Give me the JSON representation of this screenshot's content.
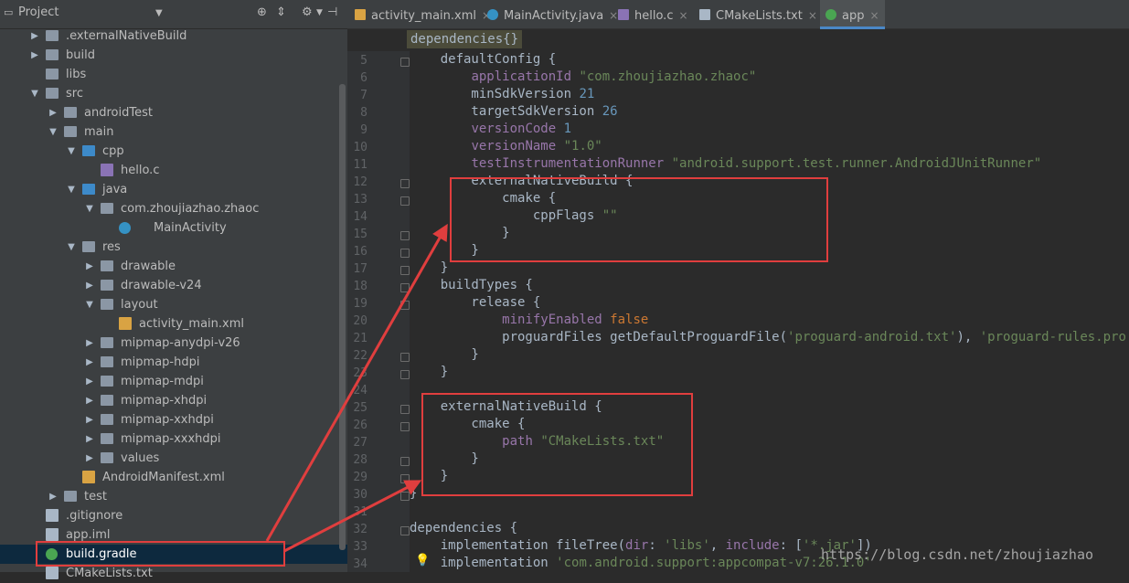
{
  "project_panel": {
    "title": "Project",
    "tree": [
      {
        "label": ".externalNativeBuild",
        "depth": 0,
        "type": "folder",
        "expanded": false
      },
      {
        "label": "build",
        "depth": 0,
        "type": "folder",
        "expanded": false
      },
      {
        "label": "libs",
        "depth": 0,
        "type": "folder",
        "expanded": null
      },
      {
        "label": "src",
        "depth": 0,
        "type": "folder",
        "expanded": true
      },
      {
        "label": "androidTest",
        "depth": 1,
        "type": "folder",
        "expanded": false
      },
      {
        "label": "main",
        "depth": 1,
        "type": "folder",
        "expanded": true
      },
      {
        "label": "cpp",
        "depth": 2,
        "type": "folder-blue",
        "expanded": true
      },
      {
        "label": "hello.c",
        "depth": 3,
        "type": "file-c",
        "expanded": null
      },
      {
        "label": "java",
        "depth": 2,
        "type": "folder-blue",
        "expanded": true
      },
      {
        "label": "com.zhoujiazhao.zhaoc",
        "depth": 3,
        "type": "package",
        "expanded": true
      },
      {
        "label": "MainActivity",
        "depth": 4,
        "type": "class",
        "expanded": null
      },
      {
        "label": "res",
        "depth": 2,
        "type": "folder",
        "expanded": true
      },
      {
        "label": "drawable",
        "depth": 3,
        "type": "folder",
        "expanded": false
      },
      {
        "label": "drawable-v24",
        "depth": 3,
        "type": "folder",
        "expanded": false
      },
      {
        "label": "layout",
        "depth": 3,
        "type": "folder",
        "expanded": true
      },
      {
        "label": "activity_main.xml",
        "depth": 4,
        "type": "file-xml",
        "expanded": null
      },
      {
        "label": "mipmap-anydpi-v26",
        "depth": 3,
        "type": "folder",
        "expanded": false
      },
      {
        "label": "mipmap-hdpi",
        "depth": 3,
        "type": "folder",
        "expanded": false
      },
      {
        "label": "mipmap-mdpi",
        "depth": 3,
        "type": "folder",
        "expanded": false
      },
      {
        "label": "mipmap-xhdpi",
        "depth": 3,
        "type": "folder",
        "expanded": false
      },
      {
        "label": "mipmap-xxhdpi",
        "depth": 3,
        "type": "folder",
        "expanded": false
      },
      {
        "label": "mipmap-xxxhdpi",
        "depth": 3,
        "type": "folder",
        "expanded": false
      },
      {
        "label": "values",
        "depth": 3,
        "type": "folder",
        "expanded": false
      },
      {
        "label": "AndroidManifest.xml",
        "depth": 2,
        "type": "file-xml",
        "expanded": null
      },
      {
        "label": "test",
        "depth": 1,
        "type": "folder",
        "expanded": false
      },
      {
        "label": ".gitignore",
        "depth": 0,
        "type": "file",
        "expanded": null
      },
      {
        "label": "app.iml",
        "depth": 0,
        "type": "file",
        "expanded": null
      },
      {
        "label": "build.gradle",
        "depth": 0,
        "type": "gradle",
        "expanded": null,
        "selected": true
      },
      {
        "label": "CMakeLists.txt",
        "depth": 0,
        "type": "file",
        "expanded": null
      }
    ]
  },
  "editor_tabs": [
    {
      "label": "activity_main.xml",
      "icon": "xml-file-icon",
      "active": false
    },
    {
      "label": "MainActivity.java",
      "icon": "java-class-icon",
      "active": false
    },
    {
      "label": "hello.c",
      "icon": "c-file-icon",
      "active": false
    },
    {
      "label": "CMakeLists.txt",
      "icon": "text-file-icon",
      "active": false
    },
    {
      "label": "app",
      "icon": "gradle-icon",
      "active": true
    }
  ],
  "breadcrumb": "dependencies{}",
  "code_lines": [
    {
      "n": "5",
      "text": "    defaultConfig {"
    },
    {
      "n": "6",
      "text": "        applicationId \"com.zhoujiazhao.zhaoc\""
    },
    {
      "n": "7",
      "text": "        minSdkVersion 21"
    },
    {
      "n": "8",
      "text": "        targetSdkVersion 26"
    },
    {
      "n": "9",
      "text": "        versionCode 1"
    },
    {
      "n": "10",
      "text": "        versionName \"1.0\""
    },
    {
      "n": "11",
      "text": "        testInstrumentationRunner \"android.support.test.runner.AndroidJUnitRunner\""
    },
    {
      "n": "12",
      "text": "        externalNativeBuild {"
    },
    {
      "n": "13",
      "text": "            cmake {"
    },
    {
      "n": "14",
      "text": "                cppFlags \"\""
    },
    {
      "n": "15",
      "text": "            }"
    },
    {
      "n": "16",
      "text": "        }"
    },
    {
      "n": "17",
      "text": "    }"
    },
    {
      "n": "18",
      "text": "    buildTypes {"
    },
    {
      "n": "19",
      "text": "        release {"
    },
    {
      "n": "20",
      "text": "            minifyEnabled false"
    },
    {
      "n": "21",
      "text": "            proguardFiles getDefaultProguardFile('proguard-android.txt'), 'proguard-rules.pro'"
    },
    {
      "n": "22",
      "text": "        }"
    },
    {
      "n": "23",
      "text": "    }"
    },
    {
      "n": "24",
      "text": ""
    },
    {
      "n": "25",
      "text": "    externalNativeBuild {"
    },
    {
      "n": "26",
      "text": "        cmake {"
    },
    {
      "n": "27",
      "text": "            path \"CMakeLists.txt\""
    },
    {
      "n": "28",
      "text": "        }"
    },
    {
      "n": "29",
      "text": "    }"
    },
    {
      "n": "30",
      "text": "}"
    },
    {
      "n": "31",
      "text": ""
    },
    {
      "n": "32",
      "text": "dependencies {"
    },
    {
      "n": "33",
      "text": "    implementation fileTree(dir: 'libs', include: ['*.jar'])"
    },
    {
      "n": "34",
      "text": "    implementation 'com.android.support:appcompat-v7:26.1.0'"
    }
  ],
  "watermark": "https://blog.csdn.net/zhoujiazhao",
  "colors": {
    "annotation": "#e03e3e",
    "keyword": "#cc7832",
    "string": "#6a8759",
    "number": "#6897bb",
    "property": "#9876aa"
  }
}
